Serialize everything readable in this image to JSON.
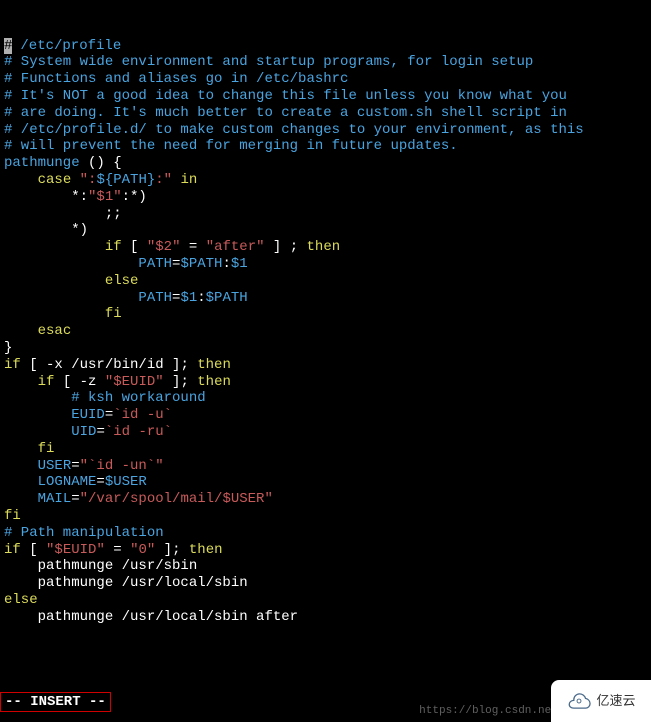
{
  "editor": {
    "cursor_char": "#",
    "lines": [
      [
        {
          "t": " /etc/profile",
          "c": "comment"
        }
      ],
      [
        {
          "t": "",
          "c": "plain"
        }
      ],
      [
        {
          "t": "# System wide environment and startup programs, for login setup",
          "c": "comment"
        }
      ],
      [
        {
          "t": "# Functions and aliases go in /etc/bashrc",
          "c": "comment"
        }
      ],
      [
        {
          "t": "",
          "c": "plain"
        }
      ],
      [
        {
          "t": "# It's NOT a good idea to change this file unless you know what you",
          "c": "comment"
        }
      ],
      [
        {
          "t": "# are doing. It's much better to create a custom.sh shell script in",
          "c": "comment"
        }
      ],
      [
        {
          "t": "# /etc/profile.d/ to make custom changes to your environment, as this",
          "c": "comment"
        }
      ],
      [
        {
          "t": "# will prevent the need for merging in future updates.",
          "c": "comment"
        }
      ],
      [
        {
          "t": "",
          "c": "plain"
        }
      ],
      [
        {
          "t": "pathmunge",
          "c": "ident"
        },
        {
          "t": " () {",
          "c": "plain"
        }
      ],
      [
        {
          "t": "    ",
          "c": "plain"
        },
        {
          "t": "case",
          "c": "keyword"
        },
        {
          "t": " ",
          "c": "plain"
        },
        {
          "t": "\":",
          "c": "string"
        },
        {
          "t": "${",
          "c": "ident"
        },
        {
          "t": "PATH",
          "c": "ident"
        },
        {
          "t": "}",
          "c": "ident"
        },
        {
          "t": ":\"",
          "c": "string"
        },
        {
          "t": " in",
          "c": "keyword"
        }
      ],
      [
        {
          "t": "        *:",
          "c": "plain"
        },
        {
          "t": "\"$1\"",
          "c": "string"
        },
        {
          "t": ":*)",
          "c": "plain"
        }
      ],
      [
        {
          "t": "            ;;",
          "c": "plain"
        }
      ],
      [
        {
          "t": "        *)",
          "c": "plain"
        }
      ],
      [
        {
          "t": "            ",
          "c": "plain"
        },
        {
          "t": "if",
          "c": "keyword"
        },
        {
          "t": " [ ",
          "c": "plain"
        },
        {
          "t": "\"$2\"",
          "c": "string"
        },
        {
          "t": " = ",
          "c": "plain"
        },
        {
          "t": "\"after\"",
          "c": "string"
        },
        {
          "t": " ] ; ",
          "c": "plain"
        },
        {
          "t": "then",
          "c": "keyword"
        }
      ],
      [
        {
          "t": "                ",
          "c": "plain"
        },
        {
          "t": "PATH",
          "c": "ident"
        },
        {
          "t": "=",
          "c": "plain"
        },
        {
          "t": "$PATH",
          "c": "ident"
        },
        {
          "t": ":",
          "c": "plain"
        },
        {
          "t": "$1",
          "c": "ident"
        }
      ],
      [
        {
          "t": "            ",
          "c": "plain"
        },
        {
          "t": "else",
          "c": "keyword"
        }
      ],
      [
        {
          "t": "                ",
          "c": "plain"
        },
        {
          "t": "PATH",
          "c": "ident"
        },
        {
          "t": "=",
          "c": "plain"
        },
        {
          "t": "$1",
          "c": "ident"
        },
        {
          "t": ":",
          "c": "plain"
        },
        {
          "t": "$PATH",
          "c": "ident"
        }
      ],
      [
        {
          "t": "            ",
          "c": "plain"
        },
        {
          "t": "fi",
          "c": "keyword"
        }
      ],
      [
        {
          "t": "    ",
          "c": "plain"
        },
        {
          "t": "esac",
          "c": "keyword"
        }
      ],
      [
        {
          "t": "}",
          "c": "plain"
        }
      ],
      [
        {
          "t": "",
          "c": "plain"
        }
      ],
      [
        {
          "t": "",
          "c": "plain"
        }
      ],
      [
        {
          "t": "if",
          "c": "keyword"
        },
        {
          "t": " [ -x /usr/bin/id ]; ",
          "c": "plain"
        },
        {
          "t": "then",
          "c": "keyword"
        }
      ],
      [
        {
          "t": "    ",
          "c": "plain"
        },
        {
          "t": "if",
          "c": "keyword"
        },
        {
          "t": " [ -z ",
          "c": "plain"
        },
        {
          "t": "\"$EUID\"",
          "c": "string"
        },
        {
          "t": " ]; ",
          "c": "plain"
        },
        {
          "t": "then",
          "c": "keyword"
        }
      ],
      [
        {
          "t": "        ",
          "c": "plain"
        },
        {
          "t": "# ksh workaround",
          "c": "comment"
        }
      ],
      [
        {
          "t": "        ",
          "c": "plain"
        },
        {
          "t": "EUID",
          "c": "ident"
        },
        {
          "t": "=",
          "c": "plain"
        },
        {
          "t": "`id -u`",
          "c": "string"
        }
      ],
      [
        {
          "t": "        ",
          "c": "plain"
        },
        {
          "t": "UID",
          "c": "ident"
        },
        {
          "t": "=",
          "c": "plain"
        },
        {
          "t": "`id -ru`",
          "c": "string"
        }
      ],
      [
        {
          "t": "    ",
          "c": "plain"
        },
        {
          "t": "fi",
          "c": "keyword"
        }
      ],
      [
        {
          "t": "    ",
          "c": "plain"
        },
        {
          "t": "USER",
          "c": "ident"
        },
        {
          "t": "=",
          "c": "plain"
        },
        {
          "t": "\"`id -un`\"",
          "c": "string"
        }
      ],
      [
        {
          "t": "    ",
          "c": "plain"
        },
        {
          "t": "LOGNAME",
          "c": "ident"
        },
        {
          "t": "=",
          "c": "plain"
        },
        {
          "t": "$USER",
          "c": "ident"
        }
      ],
      [
        {
          "t": "    ",
          "c": "plain"
        },
        {
          "t": "MAIL",
          "c": "ident"
        },
        {
          "t": "=",
          "c": "plain"
        },
        {
          "t": "\"/var/spool/mail/$USER\"",
          "c": "string"
        }
      ],
      [
        {
          "t": "fi",
          "c": "keyword"
        }
      ],
      [
        {
          "t": "",
          "c": "plain"
        }
      ],
      [
        {
          "t": "# Path manipulation",
          "c": "comment"
        }
      ],
      [
        {
          "t": "if",
          "c": "keyword"
        },
        {
          "t": " [ ",
          "c": "plain"
        },
        {
          "t": "\"$EUID\"",
          "c": "string"
        },
        {
          "t": " = ",
          "c": "plain"
        },
        {
          "t": "\"0\"",
          "c": "string"
        },
        {
          "t": " ]; ",
          "c": "plain"
        },
        {
          "t": "then",
          "c": "keyword"
        }
      ],
      [
        {
          "t": "    pathmunge /usr/sbin",
          "c": "plain"
        }
      ],
      [
        {
          "t": "    pathmunge /usr/local/sbin",
          "c": "plain"
        }
      ],
      [
        {
          "t": "else",
          "c": "keyword"
        }
      ],
      [
        {
          "t": "    pathmunge /usr/local/sbin after",
          "c": "plain"
        }
      ]
    ],
    "mode": "-- INSERT --"
  },
  "watermark": "https://blog.csdn.net/q",
  "logo_text": "亿速云"
}
